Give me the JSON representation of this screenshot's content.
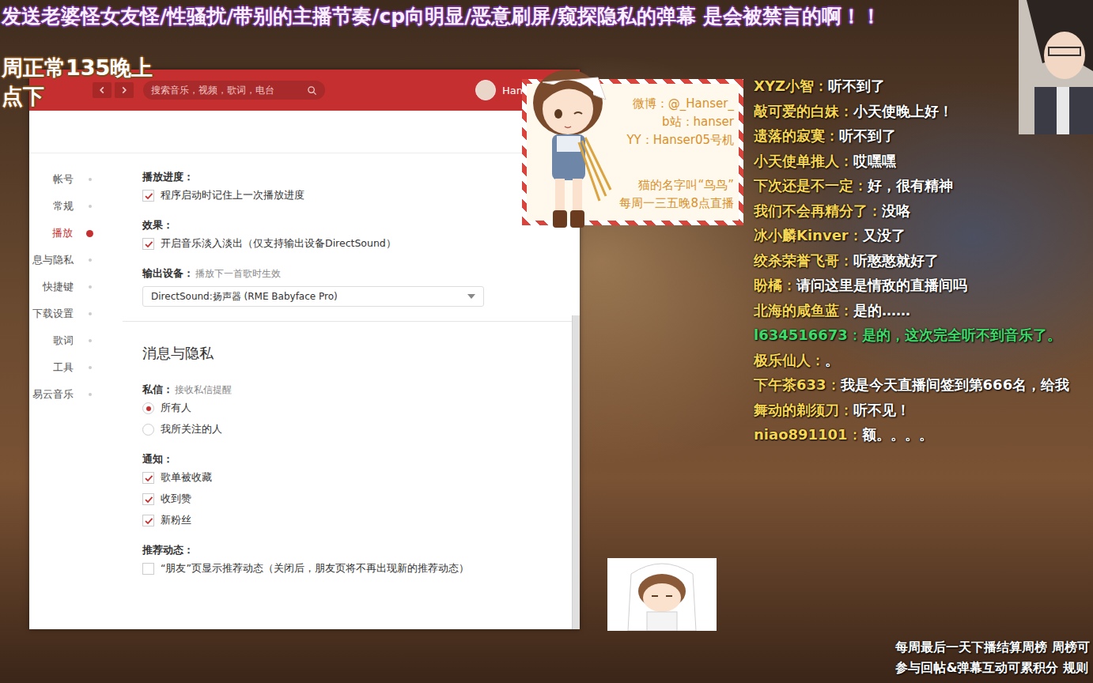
{
  "banner": {
    "rules": "发送老婆怪女友怪/性骚扰/带别的主播节奏/cp向明显/恶意刷屏/窥探隐私的弹幕 是会被禁言的啊！！",
    "schedule": [
      "周正常135晚上",
      "点下"
    ]
  },
  "music_window": {
    "search": {
      "placeholder": "搜索音乐，视频，歌词，电台"
    },
    "user": "Han",
    "nav": [
      {
        "label": "帐号",
        "selected": false
      },
      {
        "label": "常规",
        "selected": false
      },
      {
        "label": "播放",
        "selected": true
      },
      {
        "label": "息与隐私",
        "selected": false
      },
      {
        "label": "快捷键",
        "selected": false
      },
      {
        "label": "下载设置",
        "selected": false
      },
      {
        "label": "歌词",
        "selected": false
      },
      {
        "label": "工具",
        "selected": false
      },
      {
        "label": "易云音乐",
        "selected": false
      }
    ],
    "sections": [
      {
        "groups": [
          {
            "title": "播放进度：",
            "options": [
              {
                "kind": "checkbox",
                "label": "程序启动时记住上一次播放进度",
                "checked": true
              }
            ]
          },
          {
            "title": "效果：",
            "options": [
              {
                "kind": "checkbox",
                "label": "开启音乐淡入淡出（仅支持输出设备DirectSound）",
                "checked": true
              }
            ]
          },
          {
            "title": "输出设备：",
            "hint": "播放下一首歌时生效",
            "options": [
              {
                "kind": "dropdown",
                "label": "DirectSound:扬声器 (RME Babyface Pro)"
              }
            ]
          }
        ]
      },
      {
        "heading": "消息与隐私",
        "groups": [
          {
            "title": "私信：",
            "hint": "接收私信提醒",
            "options": [
              {
                "kind": "radio",
                "label": "所有人",
                "selected": true
              },
              {
                "kind": "radio",
                "label": "我所关注的人",
                "selected": false
              }
            ]
          },
          {
            "title": "通知：",
            "options": [
              {
                "kind": "checkbox",
                "label": "歌单被收藏",
                "checked": true
              },
              {
                "kind": "checkbox",
                "label": "收到赞",
                "checked": true
              },
              {
                "kind": "checkbox",
                "label": "新粉丝",
                "checked": true
              }
            ]
          },
          {
            "title": "推荐动态：",
            "options": [
              {
                "kind": "checkbox",
                "label": "“朋友”页显示推荐动态（关闭后，朋友页将不再出现新的推荐动态）",
                "checked": false
              }
            ]
          }
        ]
      }
    ]
  },
  "info_card": {
    "contacts": [
      "微博：@_Hanser_",
      "b站：hanser",
      "YY：Hanser05号机"
    ],
    "notes": [
      "猫的名字叫“鸟鸟”",
      "每周一三五晚8点直播"
    ]
  },
  "danmaku": [
    {
      "user": "XYZ小智：",
      "text": "听不到了",
      "color": "#f7d654"
    },
    {
      "user": "敲可爱的白妹：",
      "text": "小天使晚上好！",
      "color": "#f7d654"
    },
    {
      "user": "遗落的寂寞：",
      "text": "听不到了",
      "color": "#f7d654"
    },
    {
      "user": "小天使单推人：",
      "text": "哎嘿嘿",
      "color": "#f7d654"
    },
    {
      "user": "下次还是不一定：",
      "text": "好，很有精神",
      "color": "#f7d654"
    },
    {
      "user": "我们不会再精分了：",
      "text": "没咯",
      "color": "#f7d654"
    },
    {
      "user": "冰小麟Kinver：",
      "text": "又没了",
      "color": "#f7d654"
    },
    {
      "user": "绞杀荣誉飞哥：",
      "text": "听憨憨就好了",
      "color": "#f7d654"
    },
    {
      "user": "盼橘：",
      "text": "请问这里是情敌的直播间吗",
      "color": "#f7d654"
    },
    {
      "user": "北海的咸鱼蓝：",
      "text": "是的……",
      "color": "#f7d654"
    },
    {
      "user": "l634516673：",
      "text": "是的，这次完全听不到音乐了。",
      "color": "#3ddc6a"
    },
    {
      "user": "极乐仙人：",
      "text": "。",
      "color": "#f7d654"
    },
    {
      "user": "下午茶633：",
      "text": "我是今天直播间签到第666名，给我",
      "color": "#f7d654"
    },
    {
      "user": "舞动的剃须刀：",
      "text": "听不见！",
      "color": "#f7d654"
    },
    {
      "user": "niao891101：",
      "text": "额。。。。",
      "color": "#f7d654"
    }
  ],
  "footer": [
    "每周最后一天下播结算周榜 周榜可",
    "参与回帖&弹幕互动可累积分 规则"
  ]
}
